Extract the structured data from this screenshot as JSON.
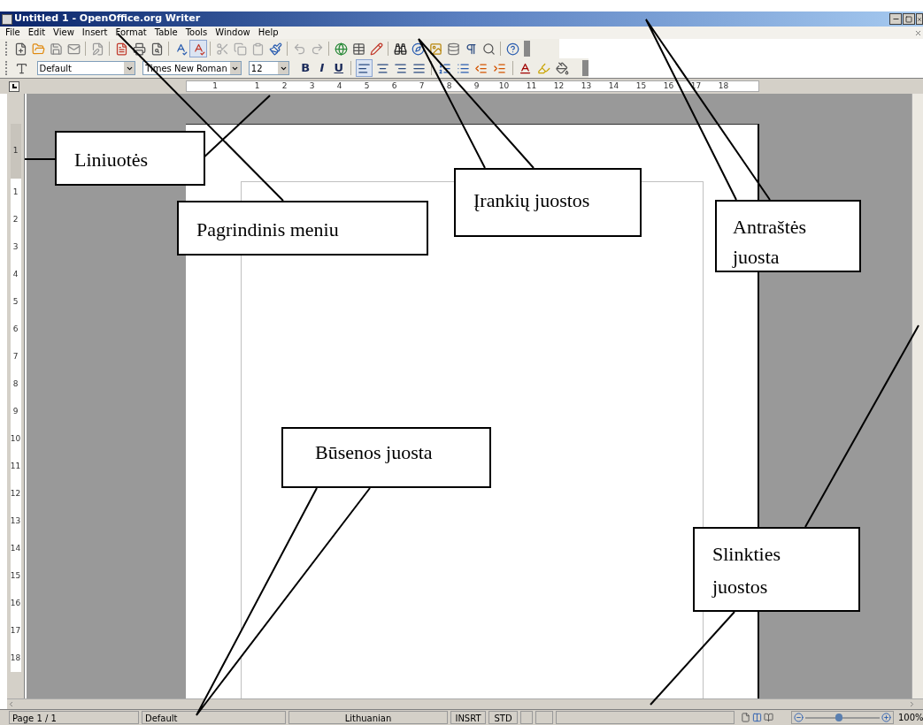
{
  "window": {
    "title": "Untitled 1 - OpenOffice.org Writer"
  },
  "menu": [
    "File",
    "Edit",
    "View",
    "Insert",
    "Format",
    "Table",
    "Tools",
    "Window",
    "Help"
  ],
  "standard_toolbar": {
    "auto_spellcheck_on": true
  },
  "formatting_toolbar": {
    "style": "Default",
    "font": "Times New Roman",
    "size": "12",
    "format_buttons": [
      "B",
      "I",
      "U"
    ],
    "align_left_on": true
  },
  "horizontal_ruler": [
    "1",
    "1",
    "2",
    "3",
    "4",
    "5",
    "6",
    "7",
    "8",
    "9",
    "10",
    "11",
    "12",
    "13",
    "14",
    "15",
    "16",
    "17",
    "18"
  ],
  "vertical_ruler": [
    "1",
    "1",
    "2",
    "3",
    "4",
    "5",
    "6",
    "7",
    "8",
    "9",
    "10",
    "11",
    "12",
    "13",
    "14",
    "15",
    "16",
    "17",
    "18"
  ],
  "callouts": [
    {
      "text": "Liniuotės"
    },
    {
      "text": "Pagrindinis meniu"
    },
    {
      "text": "Įrankių juostos"
    },
    {
      "text": "Antraštės juosta"
    },
    {
      "text": "Būsenos juosta"
    },
    {
      "text": "Slinkties juostos"
    }
  ],
  "status_bar": {
    "page": "Page 1 / 1",
    "style": "Default",
    "language": "Lithuanian",
    "insert_mode": "INSRT",
    "selection_mode": "STD",
    "zoom": {
      "level": 0.45,
      "reading": "100%"
    }
  }
}
